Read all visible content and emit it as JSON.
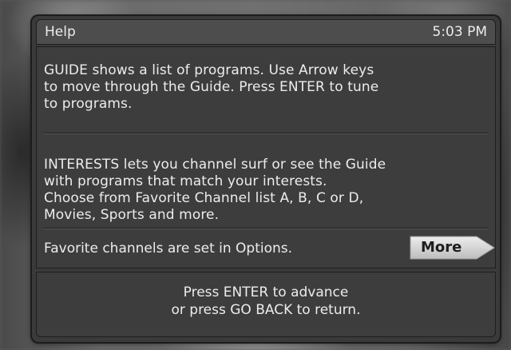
{
  "header": {
    "title": "Help",
    "time": "5:03 PM"
  },
  "help": {
    "guide_text": "GUIDE shows a list of programs.  Use Arrow keys\nto move through the Guide.  Press ENTER to tune\nto programs.",
    "interests_text": "INTERESTS lets you channel surf or see the Guide\nwith programs that match your interests.\nChoose from Favorite Channel list A, B, C or D,\nMovies, Sports and more.",
    "favorites_note": "Favorite channels are set in Options.",
    "more_label": "More"
  },
  "footer": {
    "line1": "Press ENTER to advance",
    "line2": "or press GO BACK to return."
  },
  "colors": {
    "panel": "#3a3a3a",
    "header": "#4d4d4d",
    "text": "#ececec",
    "more_button": "#d8d8d8"
  }
}
